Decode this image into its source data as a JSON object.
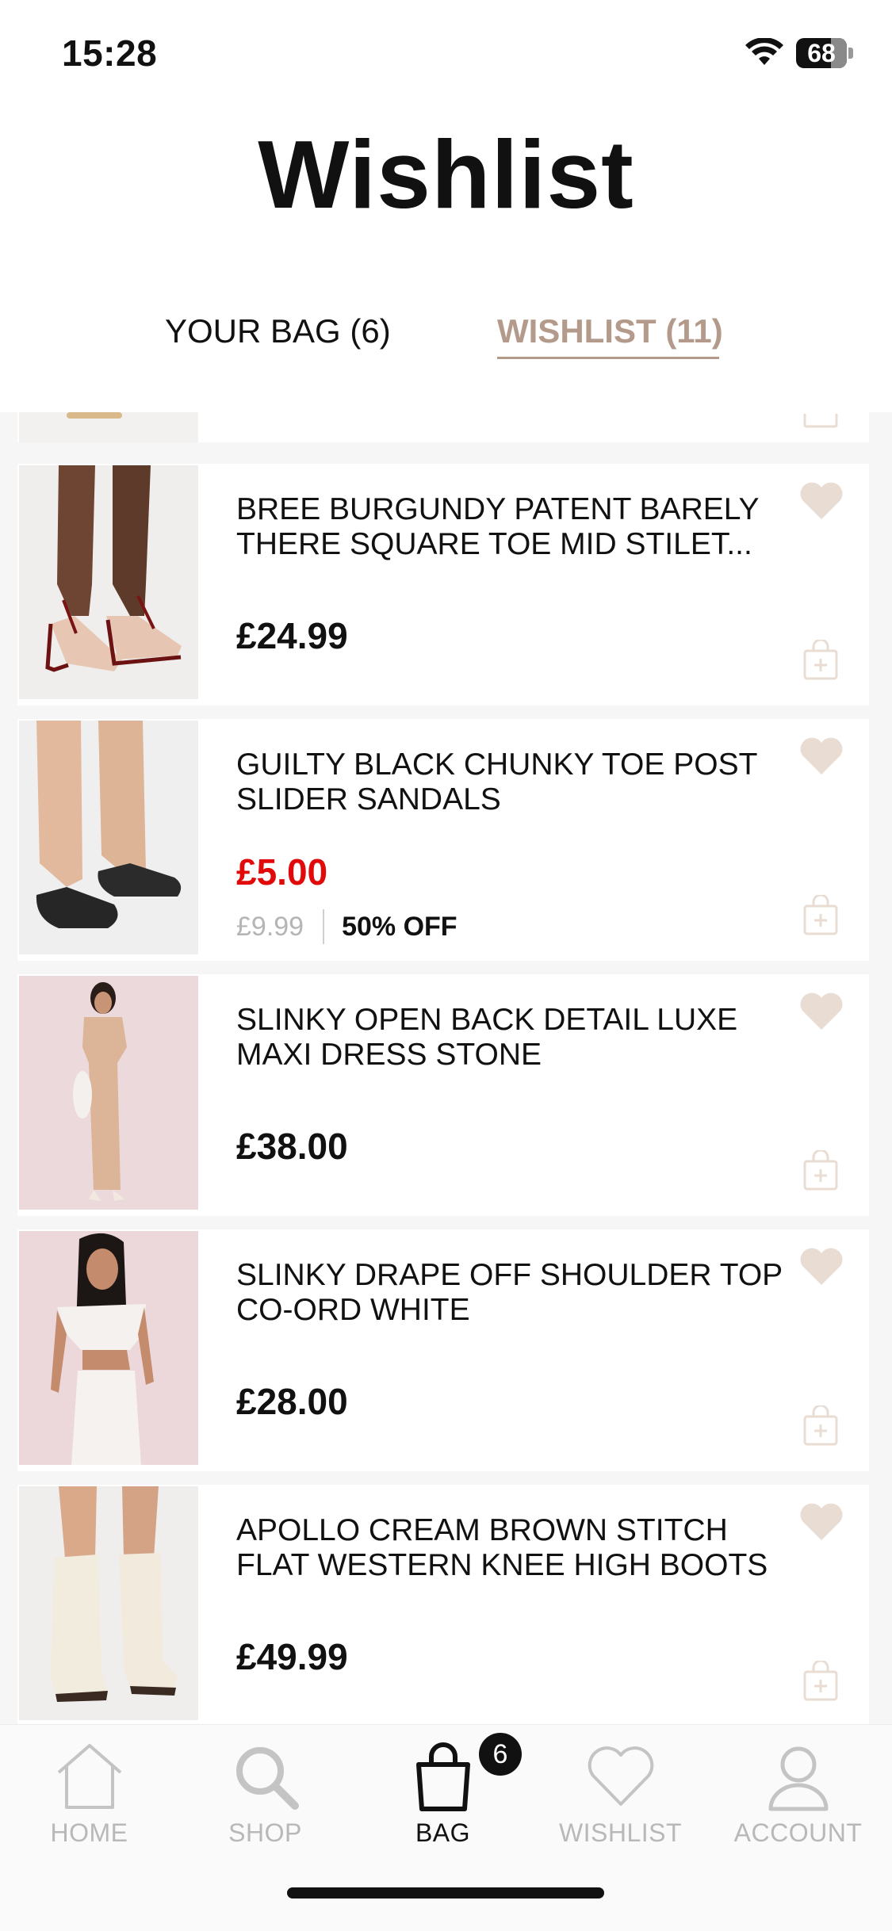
{
  "status_bar": {
    "time": "15:28",
    "battery": "68",
    "battery_level": 0.68,
    "wifi_icon": "wifi-icon"
  },
  "page_title": "Wishlist",
  "tabs": {
    "bag": "YOUR BAG (6)",
    "wishlist": "WISHLIST (11)"
  },
  "colors": {
    "accent": "#b39a8a",
    "sale_red": "#e10a0a",
    "icon_tint": "#e8dcd3"
  },
  "products": [
    {
      "name": "BREE BURGUNDY PATENT BARELY THERE SQUARE TOE MID STILET...",
      "price": "£24.99"
    },
    {
      "name": "GUILTY BLACK CHUNKY TOE POST SLIDER SANDALS",
      "price": "£5.00",
      "was_price": "£9.99",
      "discount": "50% OFF"
    },
    {
      "name": "SLINKY OPEN BACK DETAIL LUXE MAXI DRESS STONE",
      "price": "£38.00"
    },
    {
      "name": "SLINKY DRAPE OFF SHOULDER TOP CO-ORD WHITE",
      "price": "£28.00"
    },
    {
      "name": "APOLLO CREAM BROWN STITCH FLAT WESTERN KNEE HIGH BOOTS",
      "price": "£49.99"
    }
  ],
  "tab_bar": {
    "home": "HOME",
    "shop": "SHOP",
    "bag": "BAG",
    "bag_badge": "6",
    "wishlist": "WISHLIST",
    "account": "ACCOUNT"
  }
}
